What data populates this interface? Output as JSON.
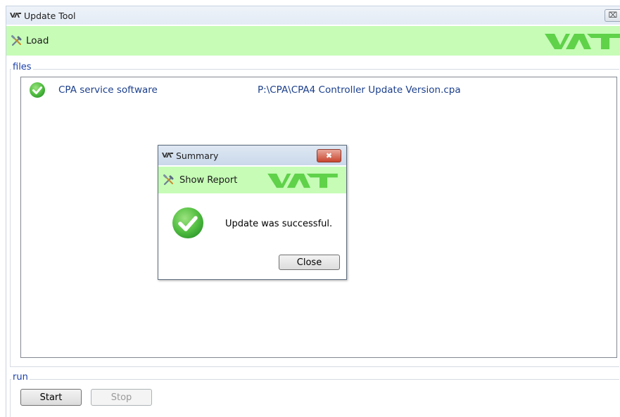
{
  "window": {
    "title": "Update Tool",
    "close_glyph": "⌧"
  },
  "toolbar": {
    "load_label": "Load",
    "logo_text": "VAT"
  },
  "files": {
    "group_label": "files",
    "items": [
      {
        "name": "CPA service software",
        "path": "P:\\CPA\\CPA4 Controller Update Version.cpa",
        "status": "ok"
      }
    ]
  },
  "run": {
    "group_label": "run",
    "start_label": "Start",
    "stop_label": "Stop"
  },
  "dialog": {
    "title": "Summary",
    "close_glyph": "✖",
    "show_report_label": "Show Report",
    "message": "Update was successful.",
    "close_label": "Close"
  },
  "colors": {
    "toolbar_bg": "#c6fcb6",
    "accent_blue": "#1b3fa8",
    "success_green": "#5cc44a",
    "logo_green": "#5fd24a"
  },
  "icons": [
    "vat-app-icon",
    "tools-icon",
    "check-circle-icon",
    "close-icon"
  ]
}
